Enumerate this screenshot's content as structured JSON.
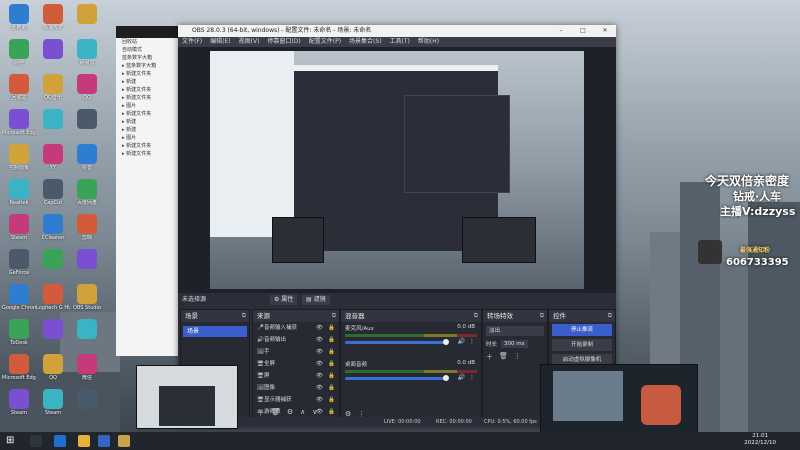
{
  "desktop": {
    "icons_col1": [
      "此电脑",
      "网络",
      "回收站",
      "Microsoft Edge",
      "控制面板",
      "Realtek",
      "Steam",
      "GeForce",
      "Google Chrome",
      "ToDesk",
      "Microsoft Edge",
      "Steam"
    ],
    "icons_col2": [
      "极速PDF",
      "",
      "QQ音乐",
      "",
      "YY",
      "CapCut",
      "CCleaner",
      "",
      "Logitech G HUB",
      "",
      "QQ",
      "Steam"
    ],
    "icons_col3": [
      "",
      "网易云",
      "QQ",
      "",
      "抖音",
      "百度网盘",
      "剪映",
      "",
      "OBS Studio",
      "",
      "微信",
      ""
    ]
  },
  "explorer": {
    "rows": [
      "回收站",
      "自动模式",
      "蓝条数字大箱",
      "▸ 蓝条数字大箱",
      "▸ 新建文件夹",
      "  ▸ 新建",
      "  ▸ 新建文件夹",
      "▸ 新建文件夹",
      "▸ 图片",
      "▸ 新建文件夹",
      "▸ 新建",
      "▸ 新建",
      "▸ 图片",
      "▸ 新建文件夹",
      "▸ 新建文件夹"
    ]
  },
  "obs": {
    "title": "OBS 28.0.3 (64-bit, windows) - 配置文件: 未命名 - 场景: 未命名",
    "menu": [
      "文件(F)",
      "编辑(E)",
      "视图(V)",
      "停靠窗口(D)",
      "配置文件(P)",
      "场景集合(S)",
      "工具(T)",
      "帮助(H)"
    ],
    "no_source": "未选择源",
    "props_btn": "属性",
    "filters_btn": "滤镜",
    "docks": {
      "scenes": {
        "title": "场景",
        "items": [
          "场景"
        ]
      },
      "sources": {
        "title": "来源",
        "items": [
          {
            "name": "音频输入捕获",
            "icon": "mic"
          },
          {
            "name": "音频输出",
            "icon": "speaker"
          },
          {
            "name": "手",
            "icon": "image"
          },
          {
            "name": "全屏",
            "icon": "monitor"
          },
          {
            "name": "屏",
            "icon": "monitor"
          },
          {
            "name": "图像",
            "icon": "image"
          },
          {
            "name": "显示器捕获",
            "icon": "monitor"
          },
          {
            "name": "游戏源",
            "icon": "gamepad"
          }
        ]
      },
      "mixer": {
        "title": "混音器",
        "channels": [
          {
            "name": "麦克风/Aux",
            "db": "0.0 dB"
          },
          {
            "name": "桌面音频",
            "db": "0.0 dB"
          }
        ]
      },
      "transitions": {
        "title": "转场特效",
        "type": "淡出",
        "duration_label": "时长",
        "duration": "300 ms"
      },
      "controls": {
        "title": "控件",
        "buttons": [
          "停止推流",
          "开始录制",
          "启动虚拟摄像机",
          "工作室模式",
          "设置",
          "退出"
        ]
      }
    },
    "status": {
      "live": "LIVE: 00:00:00",
      "rec": "REC: 00:00:00",
      "cpu": "CPU: 0.5%, 60.00 fps"
    }
  },
  "overlay": {
    "line1": "今天双倍亲密度",
    "line2": "钻戒·人车",
    "line3": "主播V:dzzyss",
    "viewer_label": "最强通知粉",
    "viewer_id": "606733395"
  },
  "taskbar": {
    "time": "21:01",
    "date": "2022/12/10"
  },
  "colors": {
    "obs_bg": "#2b2e38",
    "accent": "#3a5fcd"
  }
}
